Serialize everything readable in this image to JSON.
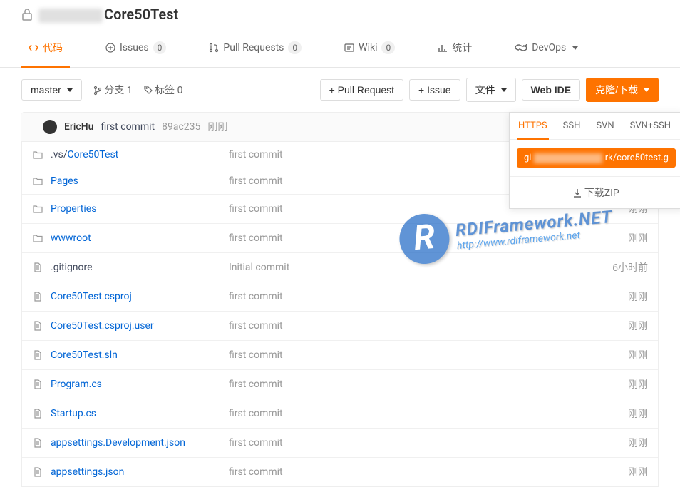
{
  "header": {
    "repo_name": "Core50Test"
  },
  "tabs": {
    "code": "代码",
    "issues": {
      "label": "Issues",
      "count": 0
    },
    "pull_requests": {
      "label": "Pull Requests",
      "count": 0
    },
    "wiki": {
      "label": "Wiki",
      "count": 0
    },
    "stats": "统计",
    "devops": "DevOps"
  },
  "toolbar": {
    "branch": "master",
    "branches_label": "分支 1",
    "tags_label": "标签 0",
    "pull_request_btn": "+ Pull Request",
    "issue_btn": "+ Issue",
    "file_btn": "文件",
    "web_ide_btn": "Web IDE",
    "clone_btn": "克隆/下载"
  },
  "clone_popup": {
    "tabs": {
      "https": "HTTPS",
      "ssh": "SSH",
      "svn": "SVN",
      "svn_ssh": "SVN+SSH"
    },
    "url_prefix": "gi",
    "url_suffix": "rk/core50test.g",
    "download_zip": "下载ZIP"
  },
  "commit": {
    "author": "EricHu",
    "message": "first commit",
    "hash": "89ac235",
    "time": "刚刚"
  },
  "files": [
    {
      "type": "folder",
      "name_prefix": ".vs/",
      "name_link": "Core50Test",
      "commit": "first commit",
      "time": ""
    },
    {
      "type": "folder",
      "name_link": "Pages",
      "commit": "first commit",
      "time": ""
    },
    {
      "type": "folder",
      "name_link": "Properties",
      "commit": "first commit",
      "time": "刚刚"
    },
    {
      "type": "folder",
      "name_link": "wwwroot",
      "commit": "first commit",
      "time": "刚刚"
    },
    {
      "type": "file",
      "name": ".gitignore",
      "commit": "Initial commit",
      "time": "6小时前"
    },
    {
      "type": "file",
      "name_link": "Core50Test.csproj",
      "commit": "first commit",
      "time": "刚刚"
    },
    {
      "type": "file",
      "name_link": "Core50Test.csproj.user",
      "commit": "first commit",
      "time": "刚刚"
    },
    {
      "type": "file",
      "name_link": "Core50Test.sln",
      "commit": "first commit",
      "time": "刚刚"
    },
    {
      "type": "file",
      "name_link": "Program.cs",
      "commit": "first commit",
      "time": "刚刚"
    },
    {
      "type": "file",
      "name_link": "Startup.cs",
      "commit": "first commit",
      "time": "刚刚"
    },
    {
      "type": "file",
      "name_link": "appsettings.Development.json",
      "commit": "first commit",
      "time": "刚刚"
    },
    {
      "type": "file",
      "name_link": "appsettings.json",
      "commit": "first commit",
      "time": "刚刚"
    }
  ],
  "watermark": {
    "title": "RDIFramework.NET",
    "url": "http://www.rdiframework.net"
  }
}
